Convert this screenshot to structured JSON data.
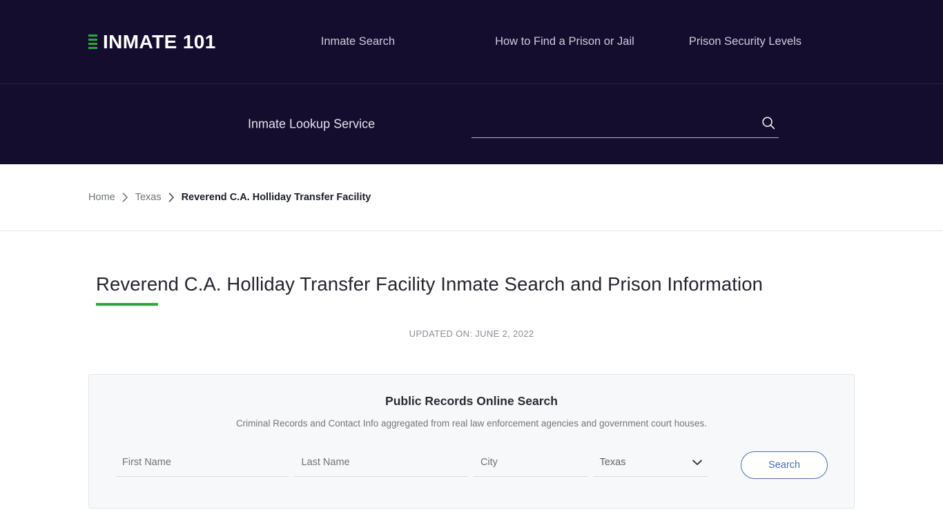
{
  "header": {
    "logo": {
      "text": "INMATE 101",
      "icon": "list-bars-icon",
      "accent_color": "#2aa83f"
    },
    "nav_items": [
      {
        "label": "Inmate Search"
      },
      {
        "label": "How to Find a Prison or Jail"
      },
      {
        "label": "Prison Security Levels"
      }
    ],
    "background_color": "#150d2e"
  },
  "search_strip": {
    "label": "Inmate Lookup Service",
    "input_value": "",
    "input_placeholder": "",
    "icon": "search-icon"
  },
  "breadcrumb": {
    "items": [
      {
        "label": "Home",
        "current": false
      },
      {
        "label": "Texas",
        "current": false
      },
      {
        "label": "Reverend C.A. Holliday Transfer Facility",
        "current": true
      }
    ],
    "separator": "chevron-right-icon"
  },
  "main": {
    "title": "Reverend C.A. Holliday Transfer Facility Inmate Search and Prison Information",
    "accent_color": "#2aa83f",
    "updated_on": "UPDATED ON: JUNE 2, 2022"
  },
  "records_card": {
    "title": "Public Records Online Search",
    "subtitle": "Criminal Records and Contact Info aggregated from real law enforcement agencies and government court houses.",
    "fields": {
      "first_name": {
        "placeholder": "First Name",
        "value": ""
      },
      "last_name": {
        "placeholder": "Last Name",
        "value": ""
      },
      "city": {
        "placeholder": "City",
        "value": ""
      },
      "state": {
        "selected": "Texas",
        "options": [
          "Texas"
        ]
      }
    },
    "submit_label": "Search",
    "submit_color": "#4a6fa8",
    "background_color": "#f7f8f9"
  }
}
